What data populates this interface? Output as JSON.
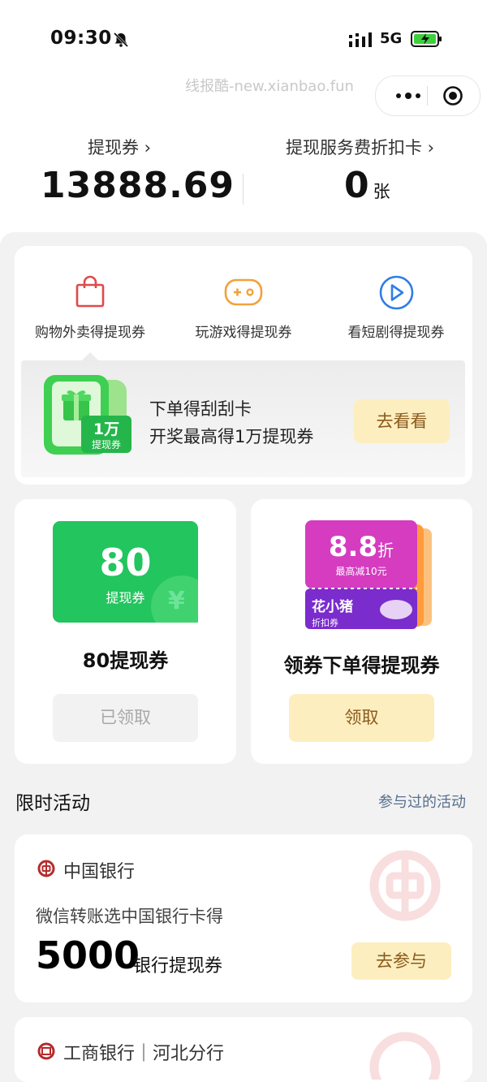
{
  "status_bar": {
    "time": "09:30",
    "network": "5G"
  },
  "watermark": "线报酷-new.xianbao.fun",
  "header": {
    "left_label": "提现券 ›",
    "left_value": "13888.69",
    "right_label": "提现服务费折扣卡 ›",
    "right_value": "0",
    "right_unit": "张"
  },
  "categories": [
    {
      "label": "购物外卖得提现券",
      "icon": "shopping-bag-icon",
      "color": "#e04a4a"
    },
    {
      "label": "玩游戏得提现券",
      "icon": "gamepad-icon",
      "color": "#f0a23c"
    },
    {
      "label": "看短剧得提现券",
      "icon": "play-icon",
      "color": "#2f7ee6"
    }
  ],
  "promo": {
    "line1": "下单得刮刮卡",
    "line2": "开奖最高得1万提现券",
    "ticket_amount": "1万",
    "ticket_label": "提现券",
    "button": "去看看"
  },
  "coupon_left": {
    "amount": "80",
    "sub": "提现券",
    "symbol": "¥",
    "title": "80提现券",
    "button": "已领取"
  },
  "coupon_right": {
    "discount": "8.8",
    "discount_unit": "折",
    "sub": "最高减10元",
    "brand": "花小猪",
    "brand_sub": "折扣券",
    "title": "领券下单得提现券",
    "button": "领取"
  },
  "section": {
    "title": "限时活动",
    "link": "参与过的活动"
  },
  "activities": [
    {
      "bank": "中国银行",
      "desc": "微信转账选中国银行卡得",
      "amount": "5000",
      "unit": "银行提现券",
      "button": "去参与"
    },
    {
      "bank": "工商银行｜河北分行"
    }
  ],
  "colors": {
    "accent_green": "#1db954",
    "button_yellow": "#fdeebf",
    "button_text": "#8a5a1e",
    "boc_red": "#b52b2b"
  }
}
